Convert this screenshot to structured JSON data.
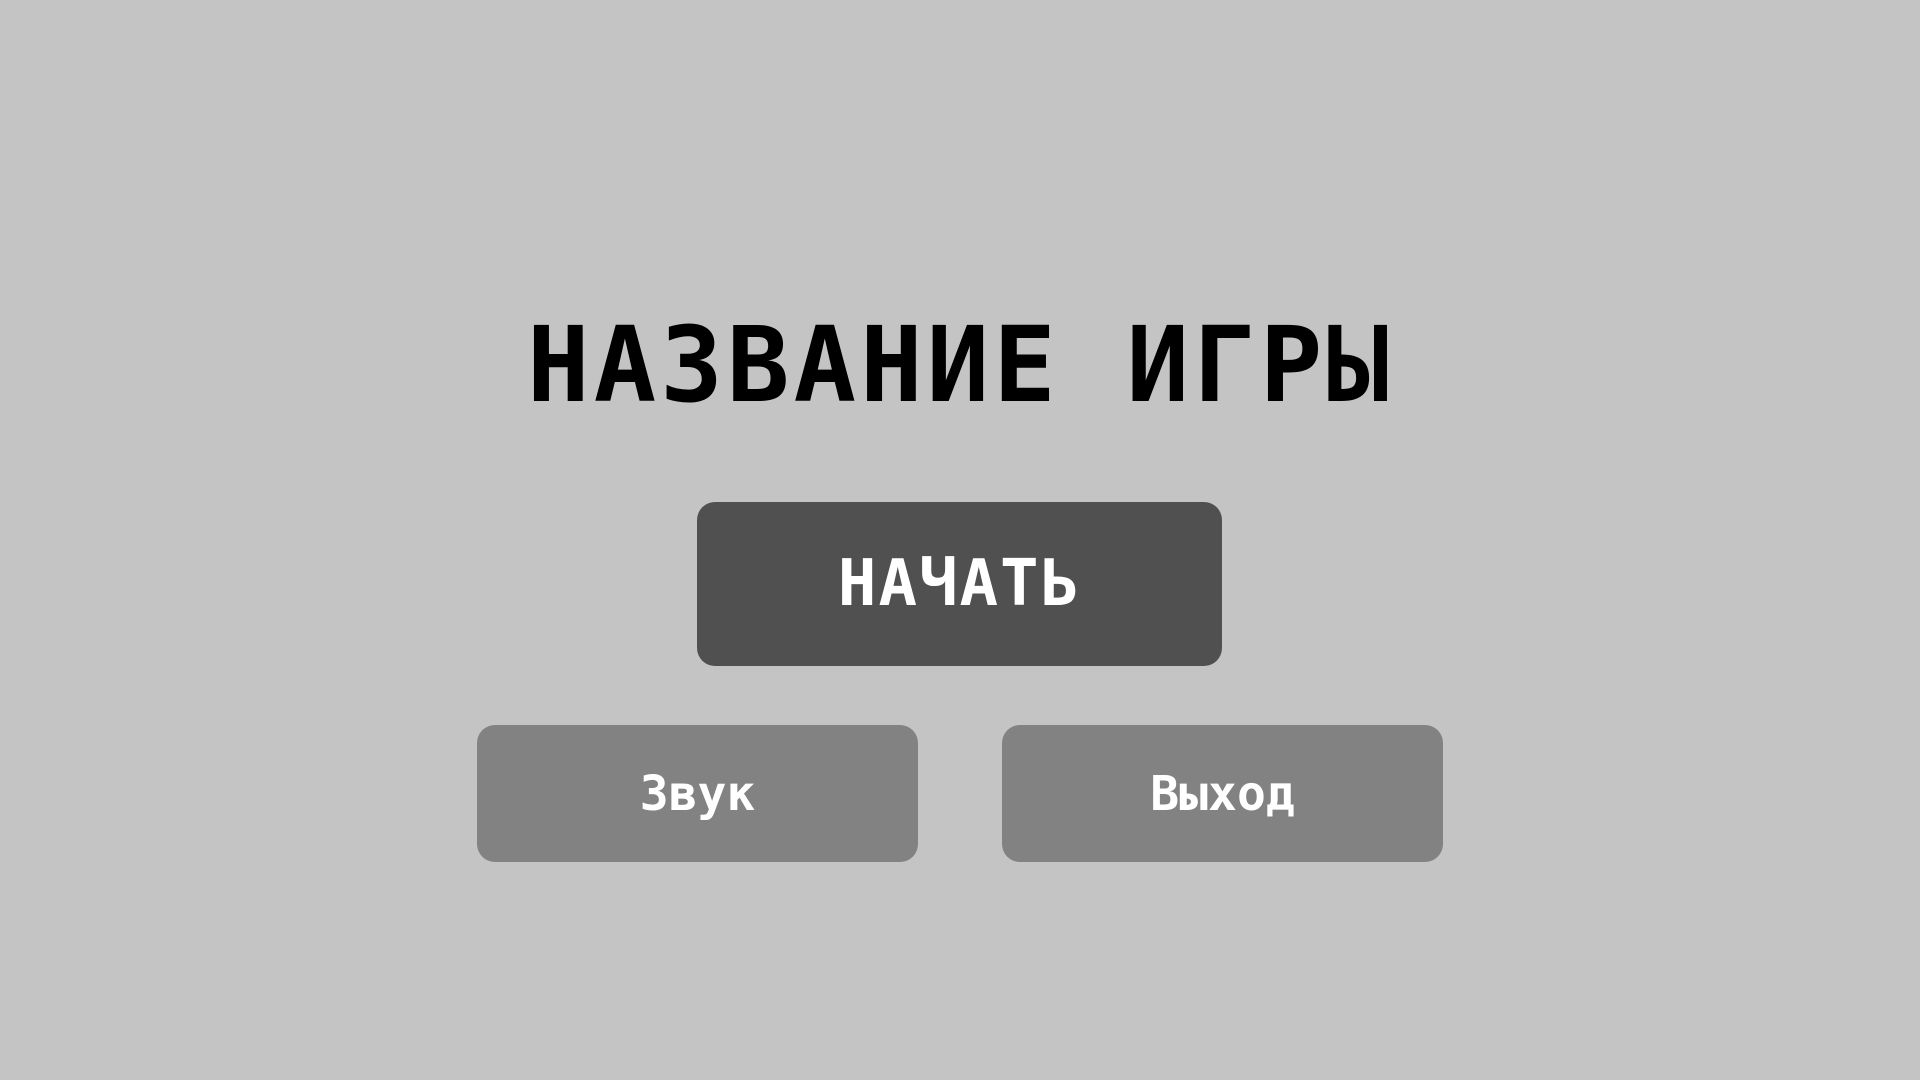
{
  "title": "НАЗВАНИЕ ИГРЫ",
  "menu": {
    "start_label": "НАЧАТЬ",
    "sound_label": "Звук",
    "exit_label": "Выход"
  },
  "colors": {
    "background": "#c4c4c4",
    "title_text": "#000000",
    "start_button_bg": "#505050",
    "secondary_button_bg": "#828282",
    "button_text": "#ffffff"
  }
}
